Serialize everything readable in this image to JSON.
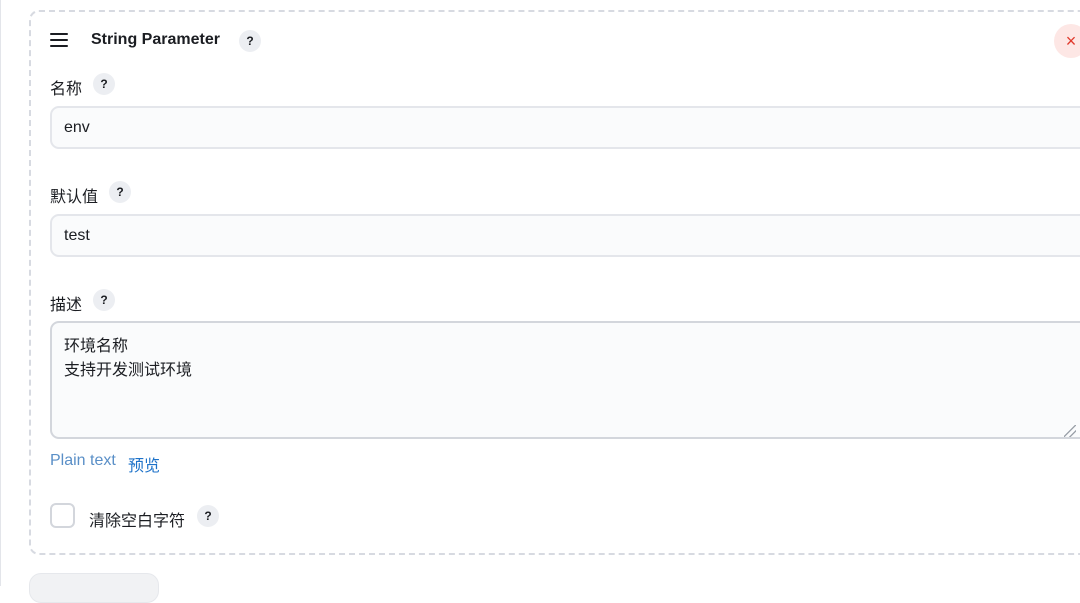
{
  "param": {
    "title": "String Parameter",
    "help_glyph": "?",
    "close_glyph": "×"
  },
  "fields": {
    "name": {
      "label": "名称",
      "value": "env"
    },
    "default": {
      "label": "默认值",
      "value": "test"
    },
    "description": {
      "label": "描述",
      "lines": [
        "环境名称",
        "支持开发测试环境"
      ]
    }
  },
  "format_links": {
    "plain": "Plain text",
    "preview": "预览"
  },
  "trim": {
    "label": "清除空白字符",
    "checked": false
  },
  "icons": [
    "hamburger-icon",
    "help-icon",
    "close-icon"
  ],
  "colors": {
    "close_fg": "#e0392b",
    "link": "#1d72c9"
  }
}
